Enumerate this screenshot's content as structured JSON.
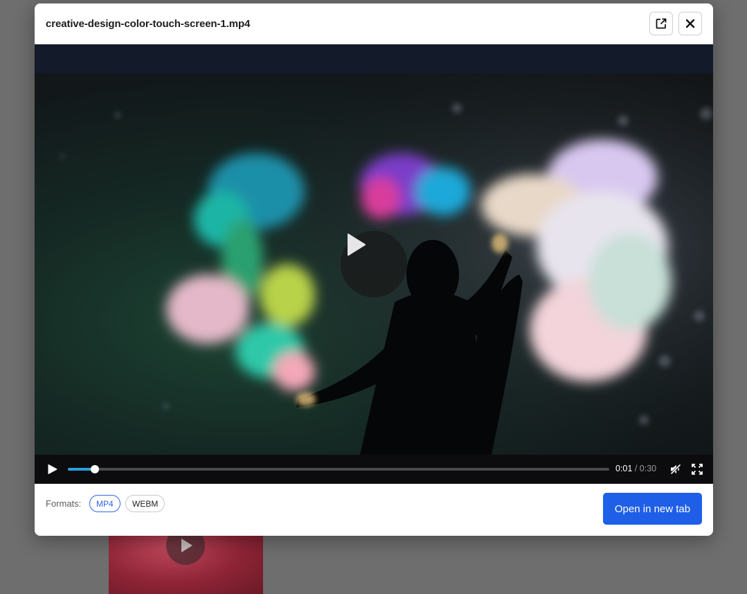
{
  "modal": {
    "title": "creative-design-color-touch-screen-1.mp4"
  },
  "player": {
    "current_time": "0:01",
    "separator": "/",
    "duration": "0:30",
    "progress_fraction": 0.05,
    "progress_color": "#2ca0e0"
  },
  "footer": {
    "formats_label": "Formats:",
    "formats": [
      {
        "label": "MP4",
        "selected": true
      },
      {
        "label": "WEBM",
        "selected": false
      }
    ],
    "open_button_label": "Open in new tab"
  },
  "icons": {
    "external": "external-link-icon",
    "close": "close-icon",
    "play": "play-icon",
    "mute": "muted-speaker-icon",
    "fullscreen": "fullscreen-icon"
  },
  "colors": {
    "primary": "#1f5fe8",
    "selected_chip": "#2f64e6"
  }
}
